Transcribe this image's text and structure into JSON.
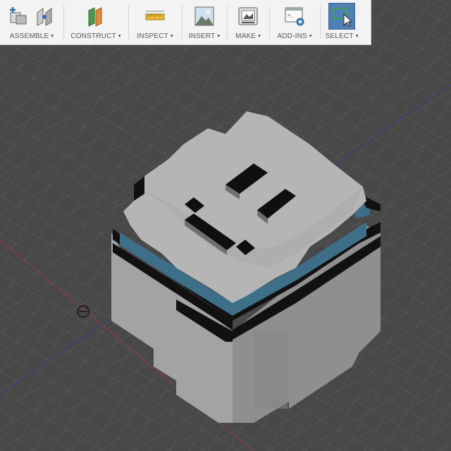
{
  "toolbar": {
    "groups": [
      {
        "label": "ASSEMBLE",
        "icons": [
          "assemble-new-component-icon",
          "joint-icon"
        ]
      },
      {
        "label": "CONSTRUCT",
        "icons": [
          "offset-plane-icon"
        ]
      },
      {
        "label": "INSPECT",
        "icons": [
          "measure-icon"
        ]
      },
      {
        "label": "INSERT",
        "icons": [
          "insert-image-icon"
        ]
      },
      {
        "label": "MAKE",
        "icons": [
          "3d-print-icon"
        ]
      },
      {
        "label": "ADD-INS",
        "icons": [
          "scripts-addins-icon"
        ]
      },
      {
        "label": "SELECT",
        "icons": [
          "window-select-icon"
        ]
      }
    ],
    "caret_glyph": "▾"
  },
  "colors": {
    "background": "#4a4a4a",
    "grid": "#5c5c5c",
    "model_light": "#a9a9a9",
    "model_mid": "#9a9a9a",
    "model_top": "#b5b5b5",
    "accent_blue": "#3e6f88",
    "x_axis": "#9a3a3a",
    "y_axis": "#3a3a8a",
    "select_active": "#4f7fb3"
  }
}
